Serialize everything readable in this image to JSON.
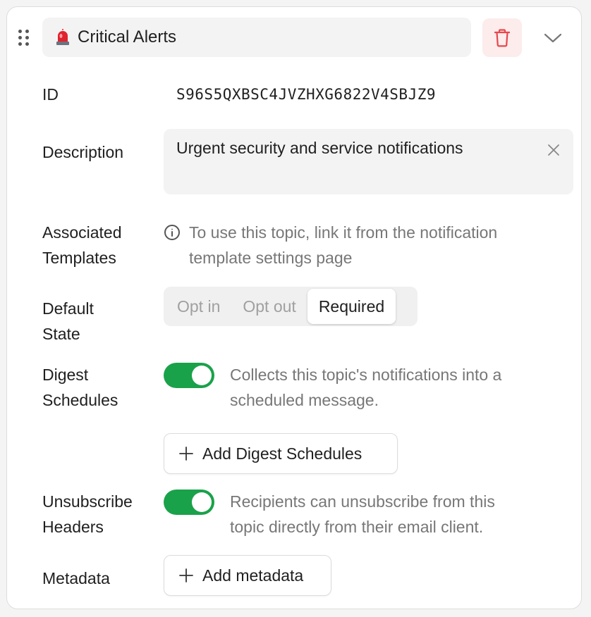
{
  "header": {
    "title": "Critical Alerts",
    "title_icon": "siren-icon",
    "delete_icon": "trash-icon",
    "expand_icon": "chevron-down-icon",
    "delete_color": "#e5484d",
    "delete_bg": "#fdecec"
  },
  "fields": {
    "id": {
      "label": "ID",
      "value": "S96S5QXBSC4JVZHXG6822V4SBJZ9"
    },
    "description": {
      "label": "Description",
      "value": "Urgent security and service notifications"
    },
    "templates": {
      "label_line1": "Associated",
      "label_line2": "Templates",
      "info_line1": "To use this topic, link it from the notification",
      "info_line2": "template settings page"
    },
    "default_state": {
      "label_line1": "Default",
      "label_line2": "State",
      "options": [
        "Opt in",
        "Opt out",
        "Required"
      ],
      "selected": "Required"
    },
    "digest": {
      "label_line1": "Digest",
      "label_line2": "Schedules",
      "enabled": true,
      "help_line1": "Collects this topic's notifications into a",
      "help_line2": "scheduled message.",
      "add_button": "Add Digest Schedules"
    },
    "unsubscribe": {
      "label_line1": "Unsubscribe",
      "label_line2": "Headers",
      "enabled": true,
      "help_line1": "Recipients can unsubscribe from this",
      "help_line2": "topic directly from their email client."
    },
    "metadata": {
      "label": "Metadata",
      "add_button": "Add metadata"
    }
  },
  "colors": {
    "toggle_on": "#1aa24a",
    "muted_text": "#777777"
  }
}
